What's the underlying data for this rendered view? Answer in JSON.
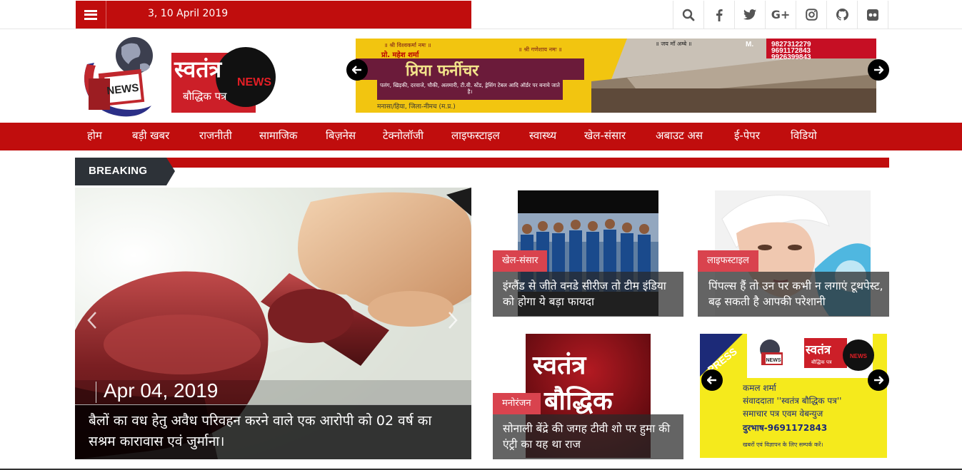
{
  "topbar": {
    "date": "3, 10 April 2019",
    "social": [
      "search-icon",
      "facebook-icon",
      "twitter-icon",
      "googleplus-icon",
      "instagram-icon",
      "github-icon",
      "flickr-icon"
    ]
  },
  "logo": {
    "globe_label": "NEWS",
    "name": "स्वतंत्र",
    "sub": "बौद्धिक पत्र",
    "badge": "NEWS"
  },
  "banner": {
    "line1": "॥ श्री विश्वकर्मा नमः ॥",
    "line2": "॥ श्री गणेशाय नमः ॥",
    "line3": "॥ जय माँ अम्बे ॥",
    "owner": "प्रो. महेश शर्मा",
    "shop": "प्रिया फर्नीचर",
    "phone_label": "M.",
    "phones": [
      "9827312279",
      "9691172843",
      "9926399843"
    ],
    "services": "पलंग, खिड़की, दरवाजे, चौकी, अलमारी, टी.वी. स्टेंड, ड्रेसिंग टेबल आदि ऑर्डर पर बनाये जाते है।",
    "address": "मनासा/हिया, जिला-नीमच (म.प्र.)"
  },
  "nav": [
    "होम",
    "बड़ी खबर",
    "राजनीती",
    "सामाजिक",
    "बिज़नेस",
    "टेक्नोलॉजी",
    "लाइफस्टाइल",
    "स्वास्थ्य",
    "खेल-संसार",
    "अबाउट अस",
    "ई-पेपर",
    "विडियो"
  ],
  "breaking": {
    "label": "BREAKING"
  },
  "main": {
    "date": "Apr 04, 2019",
    "title": "बैलों का वध हेतु अवैध परिवहन करने वाले एक आरोपी को 02 वर्ष का सश्रम कारावास एवं जुर्माना।"
  },
  "cards": [
    {
      "category": "खेल-संसार",
      "title": "इंग्लैंड से जीते वनडे सीरीज तो टीम इंडिया को होगा ये बड़ा फायदा"
    },
    {
      "category": "लाइफस्टाइल",
      "title": "पिंपल्स हैं तो उन पर कभी न लगाएं टूथपेस्ट, बढ़ सकती है आपकी परेशानी"
    },
    {
      "category": "मनोरंजन",
      "title": "सोनाली बेंद्रे की जगह टीवी शो पर हुमा की एंट्री का यह था राज",
      "image_text": [
        "स्वतंत्र",
        "बौद्धिक"
      ]
    },
    {
      "press": "PRESS",
      "logo_badge": "NEWS",
      "logo_name": "स्वतंत्र",
      "logo_sub": "बौद्धिक पत्र",
      "lines": [
        "कमल शर्मा",
        "संवाददाता ''स्वतंत्र बौद्धिक पत्र''",
        "समाचार पत्र एवम वेबन्युज",
        "दुरभाष-9691172843"
      ],
      "footer": "खबरों एवं विज्ञापन के लिए सम्पर्क करें।"
    }
  ]
}
